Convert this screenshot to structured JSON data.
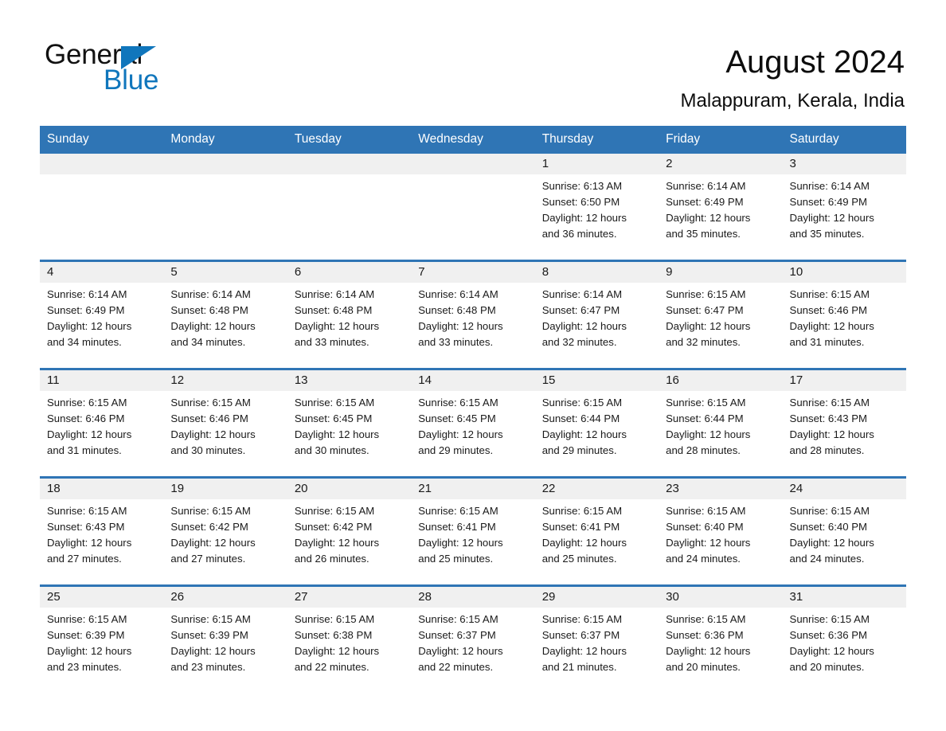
{
  "brand": {
    "name_part1": "General",
    "name_part2": "Blue",
    "triangle_icon": "triangle-icon",
    "color_dark": "#111111",
    "color_blue": "#1076bc"
  },
  "header": {
    "title": "August 2024",
    "location": "Malappuram, Kerala, India",
    "accent_color": "#2f75b5",
    "daynum_band_color": "#f0f0f0"
  },
  "weekday_headers": [
    "Sunday",
    "Monday",
    "Tuesday",
    "Wednesday",
    "Thursday",
    "Friday",
    "Saturday"
  ],
  "labels": {
    "sunrise_prefix": "Sunrise:",
    "sunset_prefix": "Sunset:",
    "daylight_prefix": "Daylight:"
  },
  "weeks": [
    [
      {
        "day": "",
        "sunrise": "",
        "sunset": "",
        "daylight_line1": "",
        "daylight_line2": ""
      },
      {
        "day": "",
        "sunrise": "",
        "sunset": "",
        "daylight_line1": "",
        "daylight_line2": ""
      },
      {
        "day": "",
        "sunrise": "",
        "sunset": "",
        "daylight_line1": "",
        "daylight_line2": ""
      },
      {
        "day": "",
        "sunrise": "",
        "sunset": "",
        "daylight_line1": "",
        "daylight_line2": ""
      },
      {
        "day": "1",
        "sunrise": "Sunrise: 6:13 AM",
        "sunset": "Sunset: 6:50 PM",
        "daylight_line1": "Daylight: 12 hours",
        "daylight_line2": "and 36 minutes."
      },
      {
        "day": "2",
        "sunrise": "Sunrise: 6:14 AM",
        "sunset": "Sunset: 6:49 PM",
        "daylight_line1": "Daylight: 12 hours",
        "daylight_line2": "and 35 minutes."
      },
      {
        "day": "3",
        "sunrise": "Sunrise: 6:14 AM",
        "sunset": "Sunset: 6:49 PM",
        "daylight_line1": "Daylight: 12 hours",
        "daylight_line2": "and 35 minutes."
      }
    ],
    [
      {
        "day": "4",
        "sunrise": "Sunrise: 6:14 AM",
        "sunset": "Sunset: 6:49 PM",
        "daylight_line1": "Daylight: 12 hours",
        "daylight_line2": "and 34 minutes."
      },
      {
        "day": "5",
        "sunrise": "Sunrise: 6:14 AM",
        "sunset": "Sunset: 6:48 PM",
        "daylight_line1": "Daylight: 12 hours",
        "daylight_line2": "and 34 minutes."
      },
      {
        "day": "6",
        "sunrise": "Sunrise: 6:14 AM",
        "sunset": "Sunset: 6:48 PM",
        "daylight_line1": "Daylight: 12 hours",
        "daylight_line2": "and 33 minutes."
      },
      {
        "day": "7",
        "sunrise": "Sunrise: 6:14 AM",
        "sunset": "Sunset: 6:48 PM",
        "daylight_line1": "Daylight: 12 hours",
        "daylight_line2": "and 33 minutes."
      },
      {
        "day": "8",
        "sunrise": "Sunrise: 6:14 AM",
        "sunset": "Sunset: 6:47 PM",
        "daylight_line1": "Daylight: 12 hours",
        "daylight_line2": "and 32 minutes."
      },
      {
        "day": "9",
        "sunrise": "Sunrise: 6:15 AM",
        "sunset": "Sunset: 6:47 PM",
        "daylight_line1": "Daylight: 12 hours",
        "daylight_line2": "and 32 minutes."
      },
      {
        "day": "10",
        "sunrise": "Sunrise: 6:15 AM",
        "sunset": "Sunset: 6:46 PM",
        "daylight_line1": "Daylight: 12 hours",
        "daylight_line2": "and 31 minutes."
      }
    ],
    [
      {
        "day": "11",
        "sunrise": "Sunrise: 6:15 AM",
        "sunset": "Sunset: 6:46 PM",
        "daylight_line1": "Daylight: 12 hours",
        "daylight_line2": "and 31 minutes."
      },
      {
        "day": "12",
        "sunrise": "Sunrise: 6:15 AM",
        "sunset": "Sunset: 6:46 PM",
        "daylight_line1": "Daylight: 12 hours",
        "daylight_line2": "and 30 minutes."
      },
      {
        "day": "13",
        "sunrise": "Sunrise: 6:15 AM",
        "sunset": "Sunset: 6:45 PM",
        "daylight_line1": "Daylight: 12 hours",
        "daylight_line2": "and 30 minutes."
      },
      {
        "day": "14",
        "sunrise": "Sunrise: 6:15 AM",
        "sunset": "Sunset: 6:45 PM",
        "daylight_line1": "Daylight: 12 hours",
        "daylight_line2": "and 29 minutes."
      },
      {
        "day": "15",
        "sunrise": "Sunrise: 6:15 AM",
        "sunset": "Sunset: 6:44 PM",
        "daylight_line1": "Daylight: 12 hours",
        "daylight_line2": "and 29 minutes."
      },
      {
        "day": "16",
        "sunrise": "Sunrise: 6:15 AM",
        "sunset": "Sunset: 6:44 PM",
        "daylight_line1": "Daylight: 12 hours",
        "daylight_line2": "and 28 minutes."
      },
      {
        "day": "17",
        "sunrise": "Sunrise: 6:15 AM",
        "sunset": "Sunset: 6:43 PM",
        "daylight_line1": "Daylight: 12 hours",
        "daylight_line2": "and 28 minutes."
      }
    ],
    [
      {
        "day": "18",
        "sunrise": "Sunrise: 6:15 AM",
        "sunset": "Sunset: 6:43 PM",
        "daylight_line1": "Daylight: 12 hours",
        "daylight_line2": "and 27 minutes."
      },
      {
        "day": "19",
        "sunrise": "Sunrise: 6:15 AM",
        "sunset": "Sunset: 6:42 PM",
        "daylight_line1": "Daylight: 12 hours",
        "daylight_line2": "and 27 minutes."
      },
      {
        "day": "20",
        "sunrise": "Sunrise: 6:15 AM",
        "sunset": "Sunset: 6:42 PM",
        "daylight_line1": "Daylight: 12 hours",
        "daylight_line2": "and 26 minutes."
      },
      {
        "day": "21",
        "sunrise": "Sunrise: 6:15 AM",
        "sunset": "Sunset: 6:41 PM",
        "daylight_line1": "Daylight: 12 hours",
        "daylight_line2": "and 25 minutes."
      },
      {
        "day": "22",
        "sunrise": "Sunrise: 6:15 AM",
        "sunset": "Sunset: 6:41 PM",
        "daylight_line1": "Daylight: 12 hours",
        "daylight_line2": "and 25 minutes."
      },
      {
        "day": "23",
        "sunrise": "Sunrise: 6:15 AM",
        "sunset": "Sunset: 6:40 PM",
        "daylight_line1": "Daylight: 12 hours",
        "daylight_line2": "and 24 minutes."
      },
      {
        "day": "24",
        "sunrise": "Sunrise: 6:15 AM",
        "sunset": "Sunset: 6:40 PM",
        "daylight_line1": "Daylight: 12 hours",
        "daylight_line2": "and 24 minutes."
      }
    ],
    [
      {
        "day": "25",
        "sunrise": "Sunrise: 6:15 AM",
        "sunset": "Sunset: 6:39 PM",
        "daylight_line1": "Daylight: 12 hours",
        "daylight_line2": "and 23 minutes."
      },
      {
        "day": "26",
        "sunrise": "Sunrise: 6:15 AM",
        "sunset": "Sunset: 6:39 PM",
        "daylight_line1": "Daylight: 12 hours",
        "daylight_line2": "and 23 minutes."
      },
      {
        "day": "27",
        "sunrise": "Sunrise: 6:15 AM",
        "sunset": "Sunset: 6:38 PM",
        "daylight_line1": "Daylight: 12 hours",
        "daylight_line2": "and 22 minutes."
      },
      {
        "day": "28",
        "sunrise": "Sunrise: 6:15 AM",
        "sunset": "Sunset: 6:37 PM",
        "daylight_line1": "Daylight: 12 hours",
        "daylight_line2": "and 22 minutes."
      },
      {
        "day": "29",
        "sunrise": "Sunrise: 6:15 AM",
        "sunset": "Sunset: 6:37 PM",
        "daylight_line1": "Daylight: 12 hours",
        "daylight_line2": "and 21 minutes."
      },
      {
        "day": "30",
        "sunrise": "Sunrise: 6:15 AM",
        "sunset": "Sunset: 6:36 PM",
        "daylight_line1": "Daylight: 12 hours",
        "daylight_line2": "and 20 minutes."
      },
      {
        "day": "31",
        "sunrise": "Sunrise: 6:15 AM",
        "sunset": "Sunset: 6:36 PM",
        "daylight_line1": "Daylight: 12 hours",
        "daylight_line2": "and 20 minutes."
      }
    ]
  ]
}
